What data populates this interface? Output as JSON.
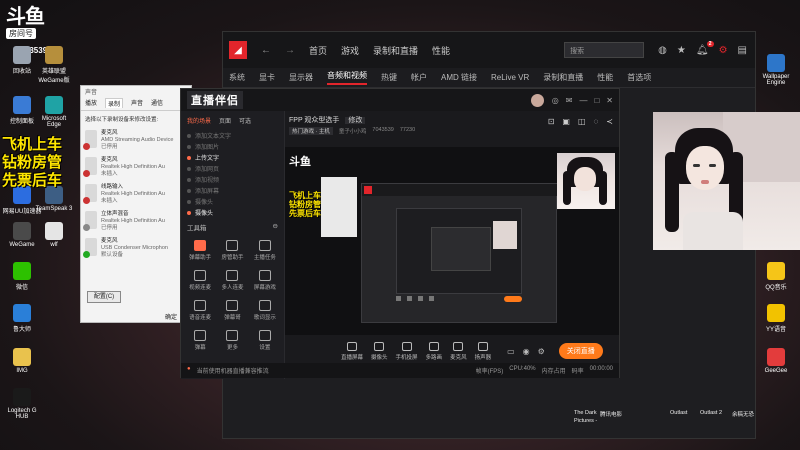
{
  "overlay": {
    "brand": "斗鱼",
    "room_label": "房间号",
    "room_id": "7043539",
    "promo_lines": [
      "飞机上车",
      "钻粉房管",
      "先票后车"
    ]
  },
  "desktop_left": [
    {
      "label": "回收站",
      "icon": "recycle-bin-icon",
      "color": "#9aa4b1"
    },
    {
      "label": "英雄联盟WeGame版",
      "icon": "lol-icon",
      "color": "#b68f3c"
    },
    {
      "label": "控制面板",
      "icon": "control-panel-icon",
      "color": "#3a7bd5"
    },
    {
      "label": "Microsoft Edge",
      "icon": "edge-icon",
      "color": "#1fa3a5"
    },
    {
      "label": "网易UU加速器",
      "icon": "uu-icon",
      "color": "#2c6de0"
    },
    {
      "label": "TeamSpeak 3",
      "icon": "teamspeak-icon",
      "color": "#3d5e84"
    },
    {
      "label": "WeGame",
      "icon": "wegame-icon",
      "color": "#4a4a4a"
    },
    {
      "label": "wlf",
      "icon": "file-icon",
      "color": "#e5e5e5"
    },
    {
      "label": "微信",
      "icon": "wechat-icon",
      "color": "#2dc100"
    },
    {
      "label": "鲁大师",
      "icon": "ludashi-icon",
      "color": "#2a7fd8"
    },
    {
      "label": "IMG",
      "icon": "folder-icon",
      "color": "#e9c24d"
    },
    {
      "label": "Logitech G HUB",
      "icon": "logitech-icon",
      "color": "#1a1a1a"
    }
  ],
  "desktop_right": [
    {
      "label": "Wallpaper Engine",
      "icon": "wallpaper-engine-icon",
      "color": "#2d76c9"
    },
    {
      "label": "QQ音乐",
      "icon": "qq-music-icon",
      "color": "#f5c518"
    },
    {
      "label": "YY语音",
      "icon": "yy-icon",
      "color": "#f2c200"
    },
    {
      "label": "GeeGee",
      "icon": "geegee-icon",
      "color": "#e33c3c"
    }
  ],
  "taskbar_text": [
    "The Dark",
    "Pictures -",
    "腾讯电影",
    "Outlast",
    "Outlast 2",
    "余稿无恐"
  ],
  "amd": {
    "logo": "AMD",
    "nav": [
      "首页",
      "游戏",
      "录制和直播",
      "性能"
    ],
    "search_placeholder": "搜索",
    "notification_count": "2",
    "subnav": [
      "系统",
      "显卡",
      "显示器",
      "音频和视频",
      "热键",
      "帐户",
      "AMD 链接",
      "ReLive VR",
      "录制和直播",
      "性能",
      "首选项"
    ],
    "active_subnav": "音频和视频"
  },
  "sound_dialog": {
    "title": "声音",
    "tabs": [
      "播放",
      "录制",
      "声音",
      "通信"
    ],
    "active_tab": "录制",
    "hint": "选择以下录制设备来修改设置:",
    "devices": [
      {
        "name": "麦克风",
        "sub": "AMD Streaming Audio Device",
        "status": "已停用",
        "dot": "#c33"
      },
      {
        "name": "麦克风",
        "sub": "Realtek High Definition Au",
        "status": "未插入",
        "dot": "#c33"
      },
      {
        "name": "线路输入",
        "sub": "Realtek High Definition Au",
        "status": "未插入",
        "dot": "#c33"
      },
      {
        "name": "立体声混音",
        "sub": "Realtek High Definition Au",
        "status": "已停用",
        "dot": "#888"
      },
      {
        "name": "麦克风",
        "sub": "USB Condenser Microphon",
        "status": "默认设备",
        "dot": "#2a2"
      }
    ],
    "button": "配置(C)",
    "ok": "确定"
  },
  "stream": {
    "logo": "直播伴侣",
    "tabs": [
      "我的场景",
      "页面",
      "可选"
    ],
    "scenes": [
      {
        "label": "添加文本文字",
        "on": false
      },
      {
        "label": "添加图片",
        "on": false
      },
      {
        "label": "上传文字",
        "on": true
      },
      {
        "label": "添加网页",
        "on": false
      },
      {
        "label": "添加视频",
        "on": false
      },
      {
        "label": "添加屏幕",
        "on": false
      },
      {
        "label": "摄像头",
        "on": false
      },
      {
        "label": "摄像头",
        "on": true
      }
    ],
    "tools_title": "工具箱",
    "tools": [
      {
        "label": "弹幕助手",
        "hot": true
      },
      {
        "label": "房管助手",
        "hot": false
      },
      {
        "label": "主播任务",
        "hot": false
      },
      {
        "label": "视频连麦",
        "hot": false
      },
      {
        "label": "多人连麦",
        "hot": false
      },
      {
        "label": "屏幕游戏",
        "hot": false
      },
      {
        "label": "语音连麦",
        "hot": false
      },
      {
        "label": "弹幕哥",
        "hot": false
      },
      {
        "label": "歌词显示",
        "hot": false
      },
      {
        "label": "弹幕",
        "hot": false
      },
      {
        "label": "更多",
        "hot": false
      },
      {
        "label": "设置",
        "hot": false
      }
    ],
    "title": "FPP 观众型选手",
    "edit": "修改",
    "category": "热门游戏 · 主机",
    "host": "童子小小鸡",
    "room": "7043539",
    "fans": "77230",
    "toolbar": [
      "直播屏幕",
      "摄像头",
      "手机投屏",
      "多路画",
      "麦克风",
      "扬声器"
    ],
    "live_button": "关闭直播",
    "alert": "当前使用机器直播兼容推流",
    "status": [
      "帧率(FPS)",
      "CPU:40%",
      "内存占用",
      "码率",
      "00:00:00"
    ]
  }
}
